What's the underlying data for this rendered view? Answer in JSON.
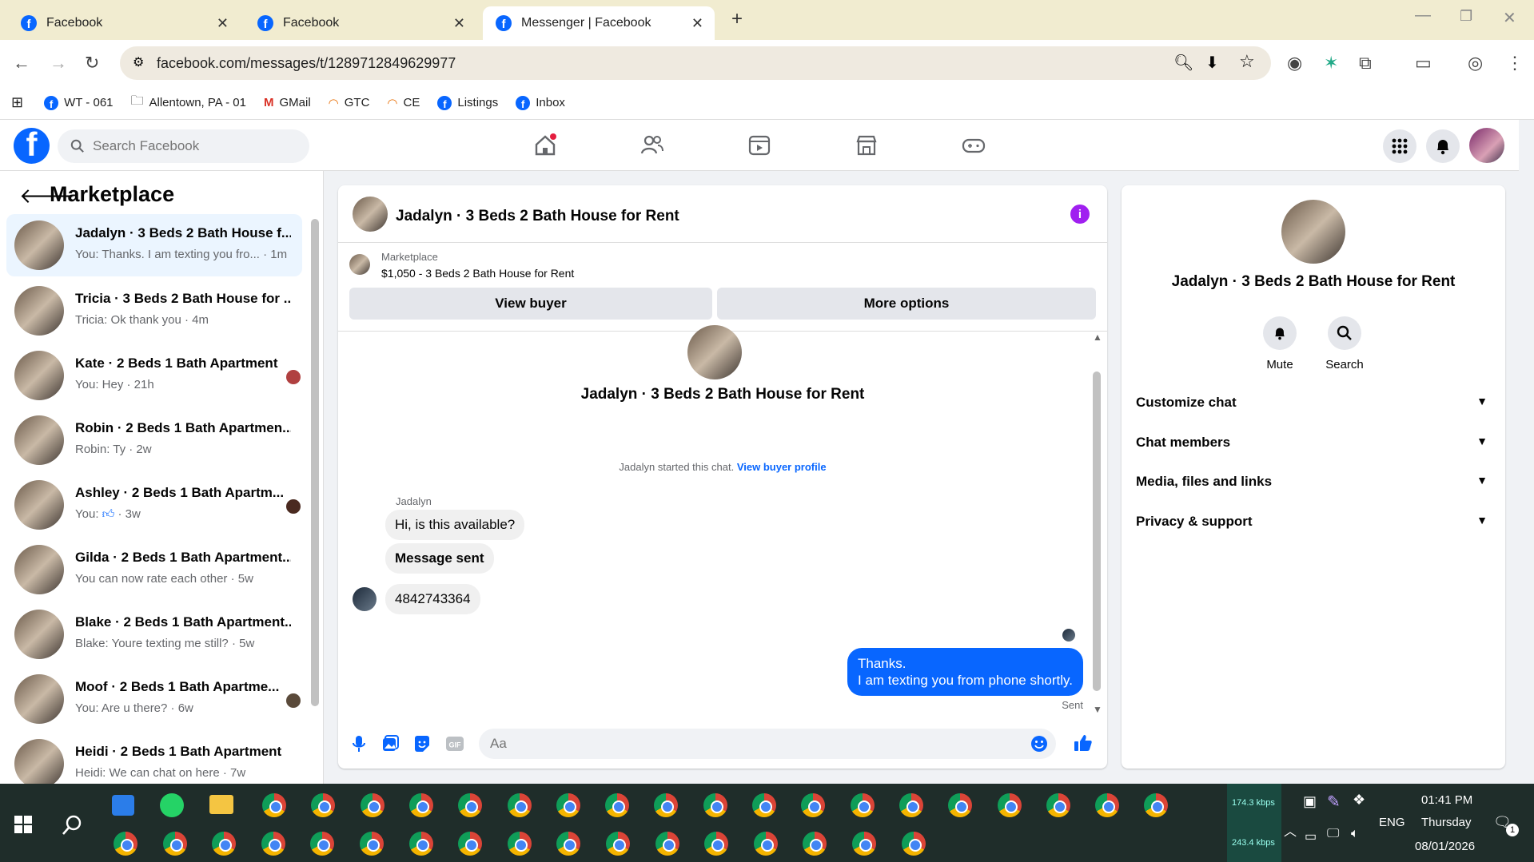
{
  "browser": {
    "tabs": [
      {
        "title": "Facebook",
        "active": false
      },
      {
        "title": "Facebook",
        "active": false
      },
      {
        "title": "Messenger | Facebook",
        "active": true
      }
    ],
    "url": "facebook.com/messages/t/1289712849629977",
    "bookmarks": [
      "WT - 061",
      "Allentown, PA - 01",
      "GMail",
      "GTC",
      "CE",
      "Listings",
      "Inbox"
    ]
  },
  "facebook": {
    "search_placeholder": "Search Facebook"
  },
  "sidebar": {
    "title": "Marketplace",
    "conversations": [
      {
        "title": "Jadalyn · 3 Beds 2 Bath House f...",
        "preview": "You: Thanks. I am texting you fro...",
        "time": "· 1m",
        "selected": true
      },
      {
        "title": "Tricia · 3 Beds 2 Bath House for ...",
        "preview": "Tricia: Ok thank you",
        "time": "· 4m",
        "selected": false
      },
      {
        "title": "Kate · 2 Beds 1 Bath Apartment",
        "preview": "You: Hey",
        "time": "· 21h",
        "selected": false
      },
      {
        "title": "Robin · 2 Beds 1 Bath Apartmen...",
        "preview": "Robin: Ty",
        "time": "· 2w",
        "selected": false
      },
      {
        "title": "Ashley · 2 Beds 1 Bath Apartm...",
        "preview": "You:",
        "time": "· 3w",
        "selected": false
      },
      {
        "title": "Gilda · 2 Beds 1 Bath Apartment...",
        "preview": "You can now rate each other",
        "time": "· 5w",
        "selected": false
      },
      {
        "title": "Blake · 2 Beds 1 Bath Apartment...",
        "preview": "Blake: Youre texting me still?",
        "time": "· 5w",
        "selected": false
      },
      {
        "title": "Moof · 2 Beds 1 Bath Apartme...",
        "preview": "You: Are u there?",
        "time": "· 6w",
        "selected": false
      },
      {
        "title": "Heidi · 2 Beds 1 Bath Apartment",
        "preview": "Heidi: We can chat on here",
        "time": "· 7w",
        "selected": false
      }
    ]
  },
  "chat": {
    "header_name": "Jadalyn · 3 Beds 2 Bath House for Rent",
    "marketplace_label": "Marketplace",
    "listing": "$1,050 - 3 Beds 2 Bath House for Rent",
    "view_buyer_label": "View buyer",
    "more_options_label": "More options",
    "conversation_name": "Jadalyn · 3 Beds 2 Bath House for Rent",
    "started_text": "Jadalyn started this chat.",
    "view_buyer_profile": "View buyer profile",
    "sender_name": "Jadalyn",
    "incoming": [
      "Hi, is this available?",
      "Message sent",
      "4842743364"
    ],
    "outgoing_line1": "Thanks.",
    "outgoing_line2": "I am texting you from phone shortly.",
    "status": "Sent",
    "composer_placeholder": "Aa"
  },
  "details": {
    "name": "Jadalyn · 3 Beds 2 Bath House for Rent",
    "mute_label": "Mute",
    "search_label": "Search",
    "sections": [
      "Customize chat",
      "Chat members",
      "Media, files and links",
      "Privacy & support"
    ]
  },
  "taskbar": {
    "net_up": "174.3 kbps",
    "net_down": "243.4 kbps",
    "language": "ENG",
    "time": "01:41 PM",
    "day": "Thursday",
    "date": "08/01/2026",
    "notification_count": "1"
  },
  "colors": {
    "brand": "#0866ff",
    "info": "#a020f0"
  }
}
